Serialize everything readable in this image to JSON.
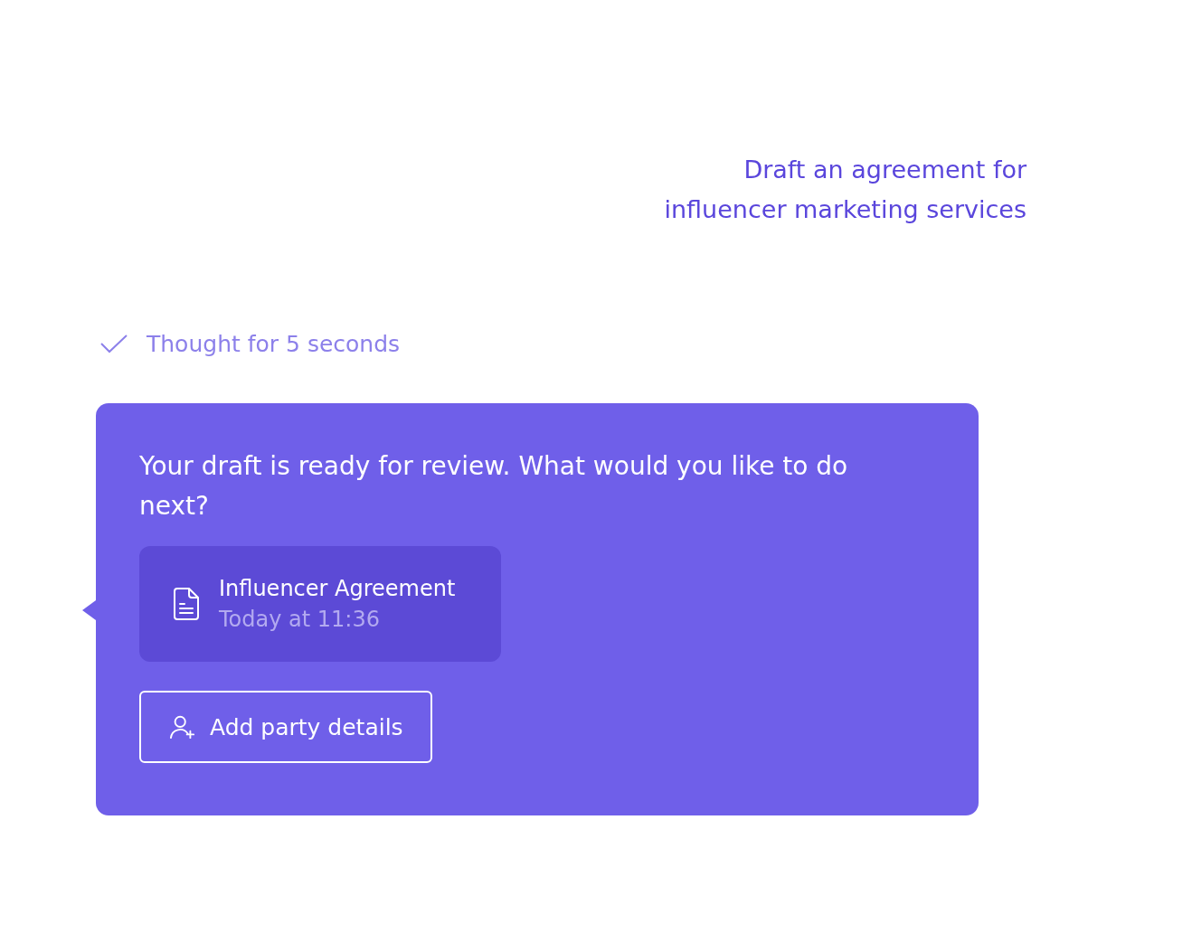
{
  "user_message": {
    "text": "Draft an agreement for\ninfluencer marketing services"
  },
  "thinking": {
    "text": "Thought for 5 seconds",
    "done": true
  },
  "reply": {
    "text": "Your draft is ready for review. What would you like to do next?",
    "document": {
      "title": "Influencer Agreement",
      "time": "Today at 11:36"
    },
    "actions": [
      {
        "kind": "add-person",
        "label": "Add party details"
      }
    ]
  }
}
